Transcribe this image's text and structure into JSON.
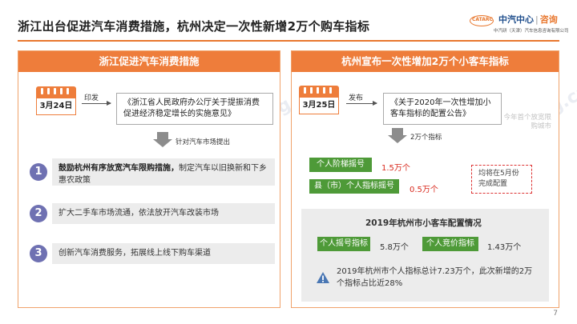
{
  "slide": {
    "title": "浙江出台促进汽车消费措施，杭州决定一次性新增2万个购车指标",
    "page_number": "7"
  },
  "logo": {
    "mark": "CATARC",
    "name": "中汽中心",
    "separator": "|",
    "consulting": "咨询",
    "subtitle": "中汽研（天津）汽车信息咨询有限公司",
    "accent": "#e8772e",
    "brand": "#1f4e8c"
  },
  "watermark": {
    "text_cn": "中国汽车工业信息网",
    "text_url": "www.autoinfo.org.cn"
  },
  "left_panel": {
    "header": "浙江促进汽车消费措施",
    "date": "3月24日",
    "action": "印发",
    "document": "《浙江省人民政府办公厅关于提振消费 促进经济稳定增长的实施意见》",
    "arrow_note": "针对汽车市场提出",
    "measures": [
      {
        "number": "1",
        "bold": "鼓励杭州有序放宽汽车限购措施，",
        "text": "制定汽车以旧换新和下乡惠农政策"
      },
      {
        "number": "2",
        "bold": "",
        "text": "扩大二手车市场流通，依法放开汽车改装市场"
      },
      {
        "number": "3",
        "bold": "",
        "text": "创新汽车消费服务，拓展线上线下购车渠道"
      }
    ],
    "accent": "#ee7d3b",
    "number_color": "#6f71b2"
  },
  "right_panel": {
    "header": "杭州宣布一次性增加2万个小客车指标",
    "date": "3月25日",
    "action": "发布",
    "document": "《关于2020年一次性增加小客车指标的配置公告》",
    "faint_note": "今年首个放宽限购城市",
    "total_note": "2万个指标",
    "allocations": [
      {
        "label": "个人阶梯摇号",
        "value": "1.5万个"
      },
      {
        "label": "县（市）个人指标摇号",
        "value": "0.5万个"
      }
    ],
    "schedule_note": "均将在5月份完成配置",
    "stats_title": "2019年杭州市小客车配置情况",
    "stats": [
      {
        "label": "个人摇号指标",
        "value": "5.8万个"
      },
      {
        "label": "个人竞价指标",
        "value": "1.43万个"
      }
    ],
    "summary": "2019年杭州市个人指标总计7.23万个，此次新增的2万个指标占比近28%",
    "tag_color": "#4e9a38",
    "value_color": "#d92a1e"
  }
}
